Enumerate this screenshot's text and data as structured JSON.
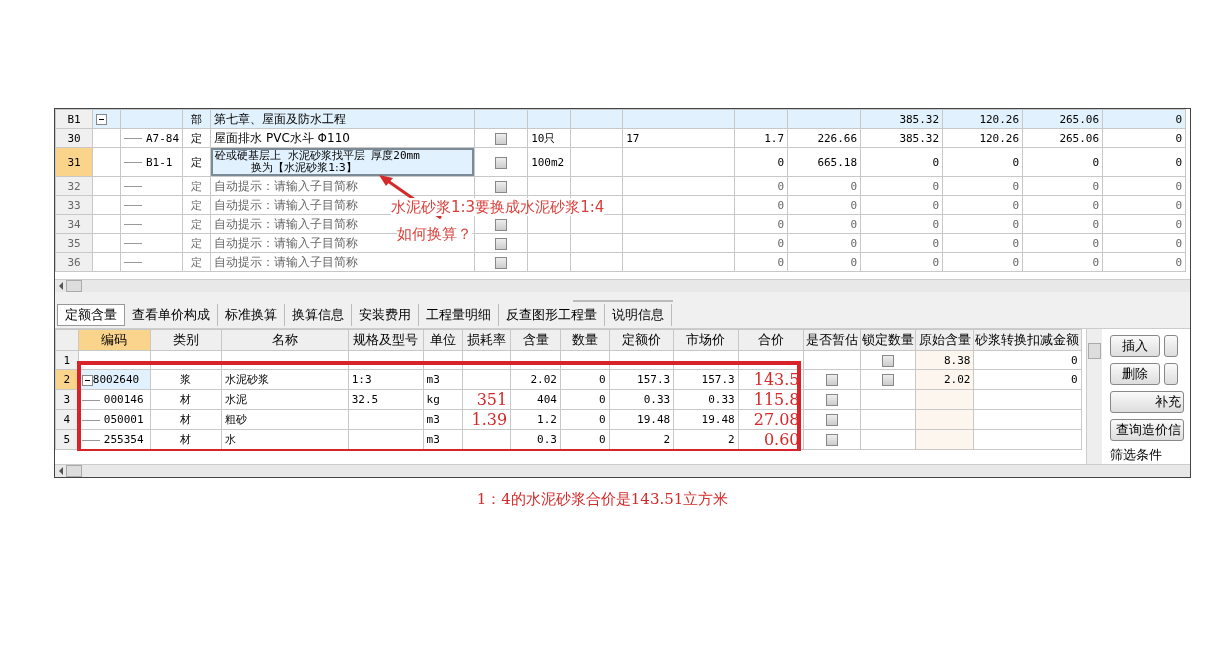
{
  "upper_grid": {
    "rows": [
      {
        "num": "B1",
        "kind": "section",
        "selected": false,
        "expanded": true,
        "type": "部",
        "name": "第七章、屋面及防水工程",
        "cells": {
          "column_12": "385.32",
          "column_13": "120.26",
          "column_14": "265.06",
          "column_15": "0"
        },
        "children": [
          {
            "num": "30",
            "kind": "item",
            "selected": false,
            "code": "A7-84",
            "type": "定",
            "name": "屋面排水 PVC水斗 Φ110",
            "checked": false,
            "unit": "10只",
            "cells": {
              "column_9": "17",
              "column_10": "1.7",
              "column_11": "226.66",
              "column_12": "385.32",
              "column_13": "120.26",
              "column_14": "265.06",
              "column_15": "0"
            }
          },
          {
            "num": "31",
            "kind": "item",
            "selected": true,
            "code": "B1-1",
            "type": "定",
            "name": "砼或硬基层上 水泥砂浆找平层 厚度20mm",
            "subline": "换为【水泥砂浆1:3】",
            "checked": false,
            "unit": "100m2",
            "cells": {
              "column_10": "0",
              "column_11": "665.18",
              "column_12": "0",
              "column_13": "0",
              "column_14": "0",
              "column_15": "0"
            }
          },
          {
            "num": "32",
            "kind": "hint",
            "selected": false,
            "type": "定",
            "name": "自动提示：请输入子目简称",
            "checked": false,
            "cells": {
              "column_10": "0",
              "column_11": "0",
              "column_12": "0",
              "column_13": "0",
              "column_14": "0",
              "column_15": "0"
            }
          },
          {
            "num": "33",
            "kind": "hint",
            "selected": false,
            "type": "定",
            "name": "自动提示：请输入子目简称",
            "cells": {
              "column_10": "0",
              "column_11": "0",
              "column_12": "0",
              "column_13": "0",
              "column_14": "0",
              "column_15": "0"
            }
          },
          {
            "num": "34",
            "kind": "hint",
            "selected": false,
            "type": "定",
            "name": "自动提示：请输入子目简称",
            "checked": false,
            "cells": {
              "column_10": "0",
              "column_11": "0",
              "column_12": "0",
              "column_13": "0",
              "column_14": "0",
              "column_15": "0"
            }
          },
          {
            "num": "35",
            "kind": "hint",
            "selected": false,
            "type": "定",
            "name": "自动提示：请输入子目简称",
            "checked": false,
            "cells": {
              "column_10": "0",
              "column_11": "0",
              "column_12": "0",
              "column_13": "0",
              "column_14": "0",
              "column_15": "0"
            }
          },
          {
            "num": "36",
            "kind": "hint",
            "selected": false,
            "type": "定",
            "name": "自动提示：请输入子目简称",
            "checked": false,
            "cells": {
              "column_10": "0",
              "column_11": "0",
              "column_12": "0",
              "column_13": "0",
              "column_14": "0",
              "column_15": "0"
            }
          }
        ]
      }
    ]
  },
  "annotation": {
    "line_1": "水泥砂浆1:3要换成水泥砂浆1:4",
    "line_2": "如何换算？"
  },
  "tabs": [
    {
      "label": "定额含量",
      "selected": true
    },
    {
      "label": "查看单价构成",
      "selected": false
    },
    {
      "label": "标准换算",
      "selected": false
    },
    {
      "label": "换算信息",
      "selected": false
    },
    {
      "label": "安装费用",
      "selected": false
    },
    {
      "label": "工程量明细",
      "selected": false
    },
    {
      "label": "反查图形工程量",
      "selected": false
    },
    {
      "label": "说明信息",
      "selected": false
    }
  ],
  "lower_grid": {
    "columns": [
      {
        "label": "编码",
        "selected": true
      },
      {
        "label": "类别",
        "selected": false
      },
      {
        "label": "名称",
        "selected": false
      },
      {
        "label": "规格及型号",
        "selected": false
      },
      {
        "label": "单位",
        "selected": false
      },
      {
        "label": "损耗率",
        "selected": false
      },
      {
        "label": "含量",
        "selected": false
      },
      {
        "label": "数量",
        "selected": false
      },
      {
        "label": "定额价",
        "selected": false
      },
      {
        "label": "市场价",
        "selected": false
      },
      {
        "label": "合价",
        "selected": false
      },
      {
        "label": "是否暂估",
        "selected": false
      },
      {
        "label": "锁定数量",
        "selected": false
      },
      {
        "label": "原始含量",
        "selected": false
      },
      {
        "label": "砂浆转换扣减金额",
        "selected": false
      }
    ],
    "rows": [
      {
        "num": "1",
        "selected": false,
        "locked": false,
        "original": "8.38",
        "deduction": "0"
      },
      {
        "num": "2",
        "selected": true,
        "expanded": true,
        "code": "8002640",
        "type": "浆",
        "name": "水泥砂浆",
        "spec": "1:3",
        "unit": "m3",
        "content": "2.02",
        "quantity": "0",
        "quota_price": "157.3",
        "market_price": "157.3",
        "total_note": "143.5",
        "estimated": false,
        "locked": false,
        "original": "2.02",
        "deduction": "0",
        "children": [
          {
            "num": "3",
            "selected": false,
            "code": "000146",
            "type": "材",
            "name": "水泥",
            "spec": "32.5",
            "unit": "kg",
            "loss_note": "351",
            "content": "404",
            "quantity": "0",
            "quota_price": "0.33",
            "market_price": "0.33",
            "total_note": "115.8",
            "estimated": false
          },
          {
            "num": "4",
            "selected": false,
            "code": "050001",
            "type": "材",
            "name": "粗砂",
            "unit": "m3",
            "loss_note": "1.39",
            "content": "1.2",
            "quantity": "0",
            "quota_price": "19.48",
            "market_price": "19.48",
            "total_note": "27.08",
            "estimated": false
          },
          {
            "num": "5",
            "selected": false,
            "code": "255354",
            "type": "材",
            "name": "水",
            "unit": "m3",
            "content": "0.3",
            "quantity": "0",
            "quota_price": "2",
            "market_price": "2",
            "total_note": "0.60",
            "estimated": false
          }
        ]
      }
    ]
  },
  "side_buttons": [
    {
      "label": "插入",
      "kind": "half"
    },
    {
      "kind": "cut"
    },
    {
      "label": "删除",
      "kind": "half"
    },
    {
      "kind": "cut"
    },
    {
      "label": "补充",
      "kind": "wide"
    },
    {
      "label": "查询造价信",
      "kind": "wide"
    }
  ],
  "filter_label": "筛选条件",
  "caption": "1：4的水泥砂浆合价是143.51立方米"
}
